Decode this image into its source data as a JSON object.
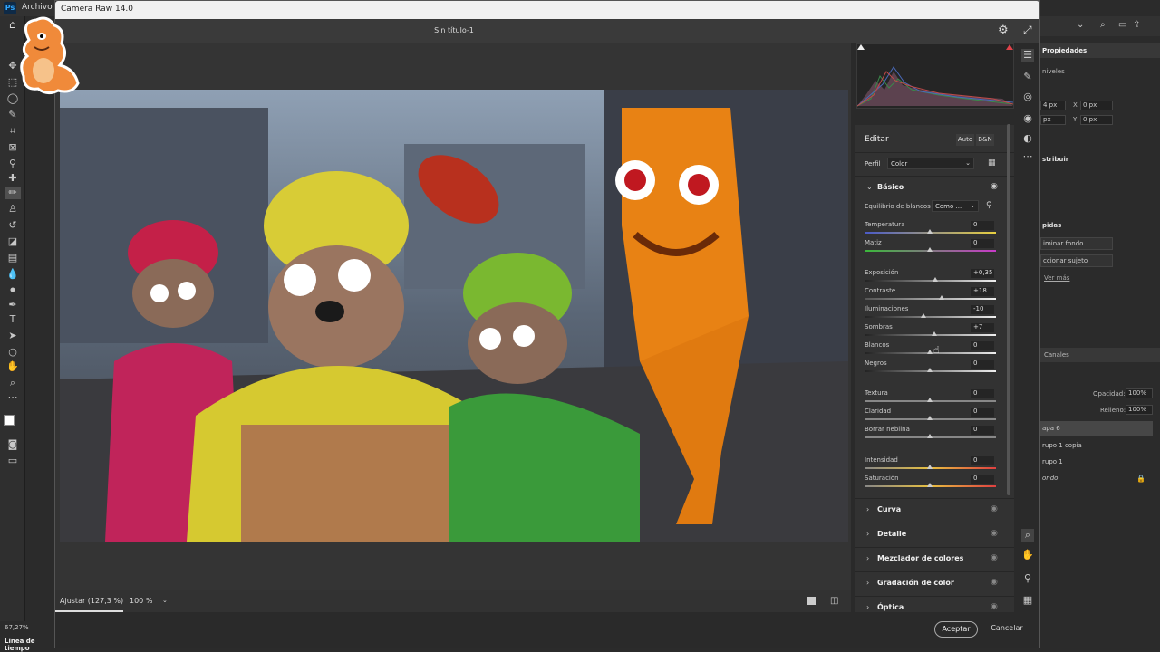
{
  "ps": {
    "logo": "Ps",
    "menu": "Archivo",
    "zoom": "67,27%",
    "timeline": "Línea de tiempo"
  },
  "camera_raw": {
    "title": "Camera Raw 14.0",
    "doc_title": "Sin título-1",
    "zoom_fit": "Ajustar (127,3 %)",
    "zoom_100": "100 %",
    "accept": "Aceptar",
    "cancel": "Cancelar",
    "edit_title": "Editar",
    "auto": "Auto",
    "bn": "B&N",
    "perfil_label": "Perfil",
    "perfil_value": "Color",
    "basic_label": "Básico",
    "wb_label": "Equilibrio de blancos",
    "wb_value": "Como ...",
    "sliders": {
      "temperatura": {
        "label": "Temperatura",
        "value": "0"
      },
      "matiz": {
        "label": "Matiz",
        "value": "0"
      },
      "exposicion": {
        "label": "Exposición",
        "value": "+0,35"
      },
      "contraste": {
        "label": "Contraste",
        "value": "+18"
      },
      "iluminaciones": {
        "label": "Iluminaciones",
        "value": "-10"
      },
      "sombras": {
        "label": "Sombras",
        "value": "+7"
      },
      "blancos": {
        "label": "Blancos",
        "value": "0"
      },
      "negros": {
        "label": "Negros",
        "value": "0"
      },
      "textura": {
        "label": "Textura",
        "value": "0"
      },
      "claridad": {
        "label": "Claridad",
        "value": "0"
      },
      "neblina": {
        "label": "Borrar neblina",
        "value": "0"
      },
      "intensidad": {
        "label": "Intensidad",
        "value": "0"
      },
      "saturacion": {
        "label": "Saturación",
        "value": "0"
      }
    },
    "sections": [
      "Curva",
      "Detalle",
      "Mezclador de colores",
      "Gradación de color",
      "Óptica"
    ]
  },
  "right_panel": {
    "propiedades": "Propiedades",
    "niveles": "niveles",
    "px1": "4 px",
    "px2": "px",
    "x_label": "X",
    "x_value": "0 px",
    "y_label": "Y",
    "y_value": "0 px",
    "distribuir": "stribuir",
    "rapidas": "pidas",
    "btn1": "iminar fondo",
    "btn2": "ccionar sujeto",
    "ver_mas": "Ver más",
    "canales": "Canales",
    "opacidad_label": "Opacidad:",
    "opacidad_value": "100%",
    "relleno_label": "Relleno:",
    "relleno_value": "100%",
    "layers": [
      "apa 6",
      "rupo 1 copia",
      "rupo 1",
      "ondo"
    ]
  },
  "colors": {
    "accent_red": "#e0424a",
    "panel_bg": "#323232",
    "canvas_bg": "#343434"
  }
}
